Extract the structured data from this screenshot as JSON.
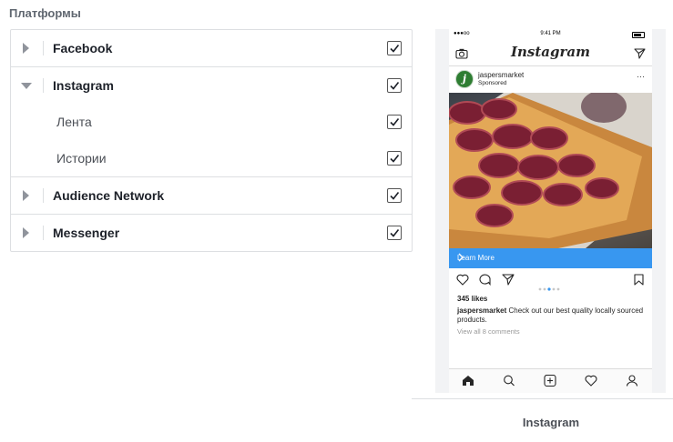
{
  "section_title": "Платформы",
  "platforms": [
    {
      "label": "Facebook",
      "expanded": false,
      "checked": true
    },
    {
      "label": "Instagram",
      "expanded": true,
      "checked": true
    },
    {
      "label": "Audience Network",
      "expanded": false,
      "checked": true
    },
    {
      "label": "Messenger",
      "expanded": false,
      "checked": true
    }
  ],
  "instagram_placements": [
    {
      "label": "Лента",
      "checked": true
    },
    {
      "label": "Истории",
      "checked": true
    }
  ],
  "preview": {
    "status_time": "9:41 PM",
    "status_signal": "●●●oo",
    "app_logo": "Instagram",
    "account": "jaspersmarket",
    "sponsored": "Sponsored",
    "more": "···",
    "cta": "Learn More",
    "likes": "345 likes",
    "caption_account": "jaspersmarket",
    "caption_text": " Check out our best quality locally sourced products.",
    "comments": "View all 8 comments",
    "cta_color": "#3897f0"
  },
  "preview_caption": "Instagram"
}
